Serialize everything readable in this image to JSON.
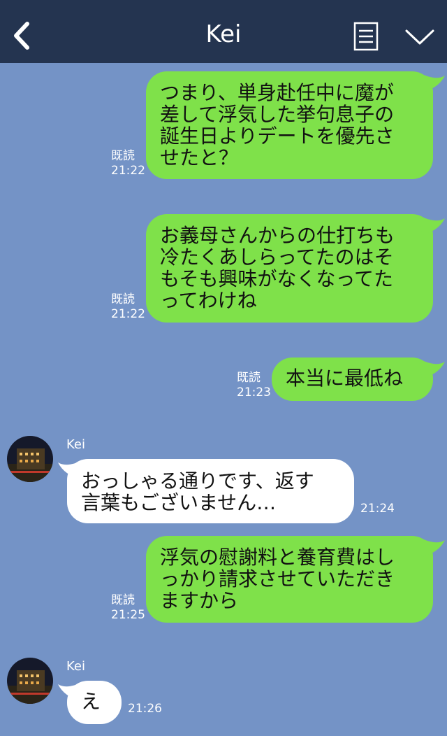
{
  "header": {
    "title": "Kei"
  },
  "messages": [
    {
      "direction": "sent",
      "lines": [
        "つまり、単身赴任中に魔が",
        "差して浮気した挙句息子の",
        "誕生日よりデートを優先さ",
        "せたと？"
      ],
      "read": "既読",
      "time": "21:22"
    },
    {
      "direction": "sent",
      "lines": [
        "お義母さんからの仕打ちも",
        "冷たくあしらってたのはそ",
        "もそも興味がなくなってた",
        "ってわけね"
      ],
      "read": "既読",
      "time": "21:22"
    },
    {
      "direction": "sent",
      "lines": [
        "本当に最低ね"
      ],
      "read": "既読",
      "time": "21:23"
    },
    {
      "direction": "received",
      "sender": "Kei",
      "lines": [
        "おっしゃる通りです、返す",
        "言葉もございません…"
      ],
      "time": "21:24"
    },
    {
      "direction": "sent",
      "lines": [
        "浮気の慰謝料と養育費はし",
        "っかり請求させていただき",
        "ますから"
      ],
      "read": "既読",
      "time": "21:25"
    },
    {
      "direction": "received",
      "sender": "Kei",
      "lines": [
        "え"
      ],
      "time": "21:26"
    }
  ],
  "icons": {
    "back": "chevron-left-icon",
    "notes": "notes-icon",
    "menu": "chevron-down-icon"
  },
  "colors": {
    "header": "#243450",
    "background": "#7493c6",
    "sent_bubble": "#7fe14a",
    "received_bubble": "#ffffff"
  }
}
